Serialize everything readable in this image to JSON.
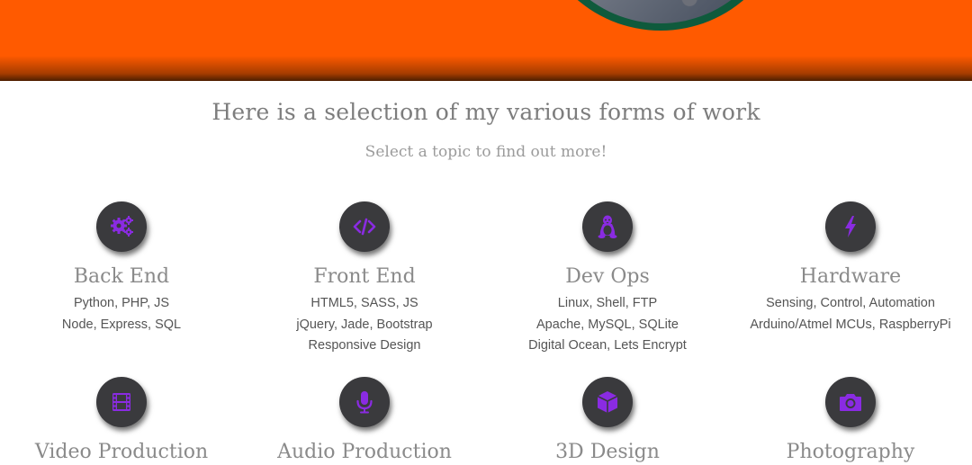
{
  "header": {
    "accent_color": "#ff5a00",
    "avatar_ring_color": "#0f5a3c"
  },
  "main": {
    "heading": "Here is a selection of my various forms of work",
    "subheading": "Select a topic to find out more!"
  },
  "topics": [
    {
      "icon": "gears-icon",
      "title": "Back End",
      "lines": [
        "Python, PHP, JS",
        "Node, Express, SQL"
      ]
    },
    {
      "icon": "code-icon",
      "title": "Front End",
      "lines": [
        "HTML5, SASS, JS",
        "jQuery, Jade, Bootstrap",
        "Responsive Design"
      ]
    },
    {
      "icon": "linux-icon",
      "title": "Dev Ops",
      "lines": [
        "Linux, Shell, FTP",
        "Apache, MySQL, SQLite",
        "Digital Ocean, Lets Encrypt"
      ]
    },
    {
      "icon": "lightning-icon",
      "title": "Hardware",
      "lines": [
        "Sensing, Control, Automation",
        "Arduino/Atmel MCUs, RaspberryPi"
      ]
    },
    {
      "icon": "film-icon",
      "title": "Video Production",
      "lines": []
    },
    {
      "icon": "microphone-icon",
      "title": "Audio Production",
      "lines": []
    },
    {
      "icon": "cube-icon",
      "title": "3D Design",
      "lines": []
    },
    {
      "icon": "camera-icon",
      "title": "Photography",
      "lines": []
    }
  ],
  "icon_color": "#8a2be2",
  "icon_bg_color": "#3a3a3d"
}
